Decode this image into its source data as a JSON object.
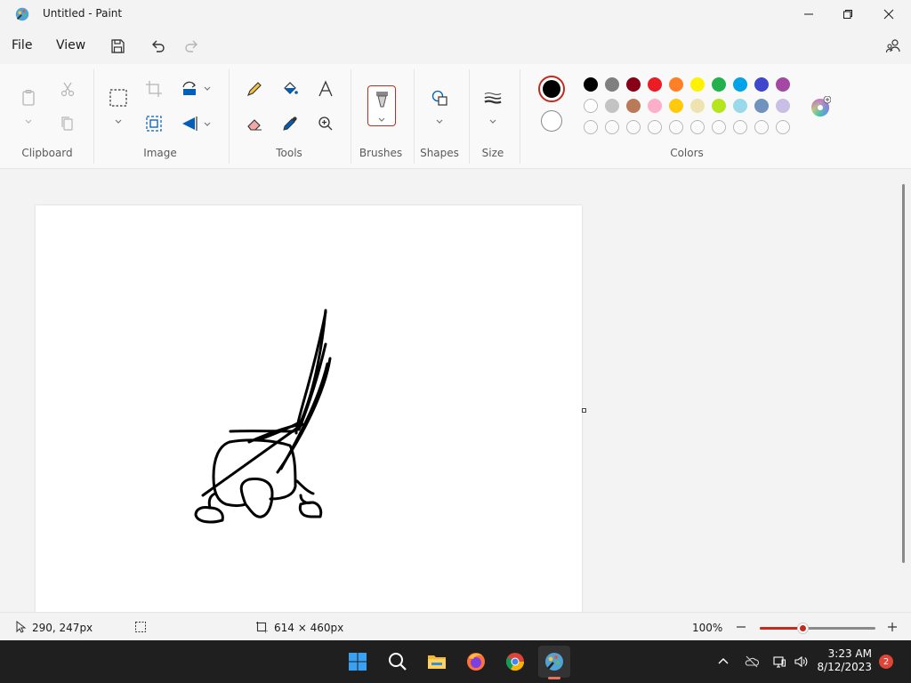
{
  "window": {
    "title": "Untitled - Paint"
  },
  "menu": {
    "file": "File",
    "view": "View"
  },
  "ribbon": {
    "groups": {
      "clipboard": "Clipboard",
      "image": "Image",
      "tools": "Tools",
      "brushes": "Brushes",
      "shapes": "Shapes",
      "size": "Size",
      "colors": "Colors"
    },
    "palette": {
      "primary": "#000000",
      "secondary": "#ffffff",
      "row1": [
        "#000000",
        "#7f7f7f",
        "#880015",
        "#ed1c24",
        "#ff7f27",
        "#fff200",
        "#22b14c",
        "#00a2e8",
        "#3f48cc",
        "#a349a4"
      ],
      "row2": [
        "#ffffff",
        "#c3c3c3",
        "#b97a57",
        "#ffaec9",
        "#ffc90e",
        "#efe4b0",
        "#b5e61d",
        "#99d9ea",
        "#7092be",
        "#c8bfe7"
      ],
      "row3_count": 10
    }
  },
  "status": {
    "cursor_position": "290, 247px",
    "canvas_size": "614 × 460px",
    "zoom": "100%",
    "zoom_fraction": 0.38
  },
  "taskbar": {
    "time": "3:23 AM",
    "date": "8/12/2023",
    "notifications": "2"
  },
  "colors": {
    "accent": "#c42b1c",
    "taskbar_bg": "#1f1f1f"
  }
}
